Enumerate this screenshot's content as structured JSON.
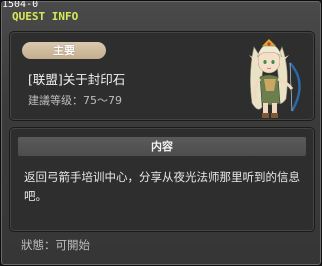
{
  "window": {
    "top_id": "1504-0",
    "title": "QUEST INFO"
  },
  "quest": {
    "category_badge": "主要",
    "name": "[联盟]关于封印石",
    "level_label": "建議等级：75～79",
    "character_icon": "elf-archer-npc-portrait"
  },
  "content": {
    "header": "内容",
    "text": "返回弓箭手培训中心，分享从夜光法师那里听到的信息吧。"
  },
  "status": {
    "label": "狀態：可開始"
  },
  "colors": {
    "title": "#d8e85a",
    "badge": "#c9b595"
  }
}
